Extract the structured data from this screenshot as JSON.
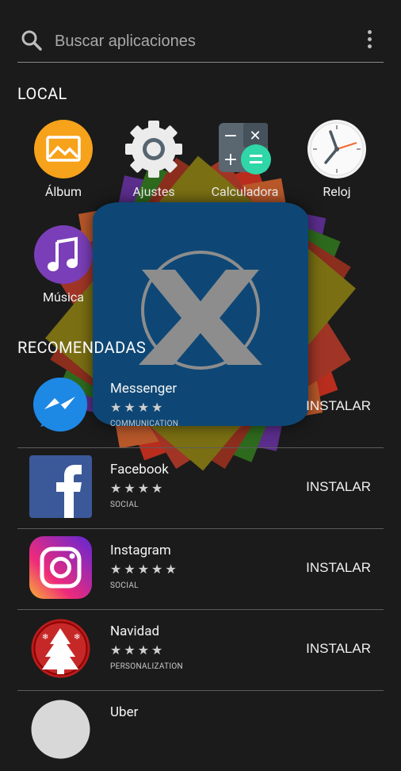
{
  "search": {
    "placeholder": "Buscar aplicaciones"
  },
  "sections": {
    "local": "LOCAL",
    "recommended": "RECOMENDADAS"
  },
  "local_apps": [
    {
      "label": "Álbum",
      "icon": "gallery-icon",
      "color": "#f7a21b"
    },
    {
      "label": "Ajustes",
      "icon": "settings-gear-icon",
      "color": "#e6e6e6"
    },
    {
      "label": "Calculadora",
      "icon": "calculator-icon",
      "color": "#5b6770"
    },
    {
      "label": "Reloj",
      "icon": "clock-icon",
      "color": "#f5f5f5"
    },
    {
      "label": "Música",
      "icon": "music-note-icon",
      "color": "#7a3fb8"
    }
  ],
  "recommended": [
    {
      "name": "Messenger",
      "rating": "★★★★",
      "category": "COMMUNICATION",
      "action": "INSTALAR",
      "icon": "messenger-icon"
    },
    {
      "name": "Facebook",
      "rating": "★★★★",
      "category": "SOCIAL",
      "action": "INSTALAR",
      "icon": "facebook-icon"
    },
    {
      "name": "Instagram",
      "rating": "★★★★★",
      "category": "SOCIAL",
      "action": "INSTALAR",
      "icon": "instagram-icon"
    },
    {
      "name": "Navidad",
      "rating": "★★★★",
      "category": "PERSONALIZATION",
      "action": "INSTALAR",
      "icon": "christmas-tree-icon"
    },
    {
      "name": "Uber",
      "icon": "uber-icon"
    }
  ],
  "colors": {
    "background": "#1b1b1b",
    "overlay_logo": "#0e4775"
  }
}
